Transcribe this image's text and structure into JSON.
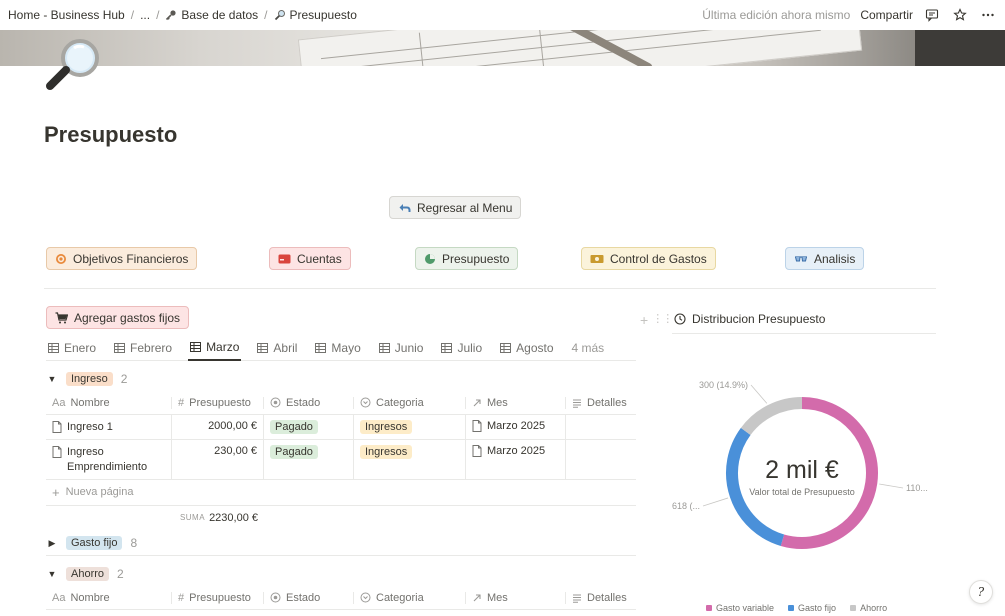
{
  "breadcrumb": {
    "home": "Home - Business Hub",
    "ellipsis": "...",
    "database": "Base de datos",
    "current": "Presupuesto"
  },
  "topbar": {
    "edited": "Última edición ahora mismo",
    "share": "Compartir"
  },
  "page": {
    "title": "Presupuesto"
  },
  "buttons": {
    "back": "Regresar al Menu",
    "objetivos": "Objetivos Financieros",
    "cuentas": "Cuentas",
    "presupuesto": "Presupuesto",
    "control": "Control de Gastos",
    "analisis": "Analisis",
    "fixed": "Agregar gastos fijos"
  },
  "tabs": [
    {
      "label": "Enero",
      "active": false
    },
    {
      "label": "Febrero",
      "active": false
    },
    {
      "label": "Marzo",
      "active": true
    },
    {
      "label": "Abril",
      "active": false
    },
    {
      "label": "Mayo",
      "active": false
    },
    {
      "label": "Junio",
      "active": false
    },
    {
      "label": "Julio",
      "active": false
    },
    {
      "label": "Agosto",
      "active": false
    }
  ],
  "tabs_more": "4 más",
  "columns": {
    "nombre": "Nombre",
    "presupuesto": "Presupuesto",
    "estado": "Estado",
    "categoria": "Categoria",
    "mes": "Mes",
    "detalles": "Detalles",
    "aa": "Aa"
  },
  "groups": {
    "ingreso": {
      "label": "Ingreso",
      "count": "2"
    },
    "gasto_fijo": {
      "label": "Gasto fijo",
      "count": "8"
    },
    "ahorro": {
      "label": "Ahorro",
      "count": "2"
    }
  },
  "rows": [
    {
      "name": "Ingreso 1",
      "budget": "2000,00 €",
      "status": "Pagado",
      "category": "Ingresos",
      "month": "Marzo 2025"
    },
    {
      "name": "Ingreso Emprendimiento",
      "budget": "230,00 €",
      "status": "Pagado",
      "category": "Ingresos",
      "month": "Marzo 2025"
    }
  ],
  "new_page": "Nueva página",
  "sum": {
    "label": "SUMA",
    "value": "2230,00 €"
  },
  "chart_title": "Distribucion Presupuesto",
  "chart_data": {
    "type": "pie",
    "title": "Distribucion Presupuesto",
    "center_value": "2 mil €",
    "center_label": "Valor total de Presupuesto",
    "series": [
      {
        "name": "Gasto variable",
        "value": 1100,
        "label": "110...",
        "color": "#d36bab"
      },
      {
        "name": "Gasto fijo",
        "value": 618,
        "label": "618 (...",
        "color": "#4a90d9"
      },
      {
        "name": "Ahorro",
        "value": 300,
        "label": "300 (14.9%)",
        "color": "#c7c7c7"
      }
    ],
    "legend_position": "bottom"
  }
}
